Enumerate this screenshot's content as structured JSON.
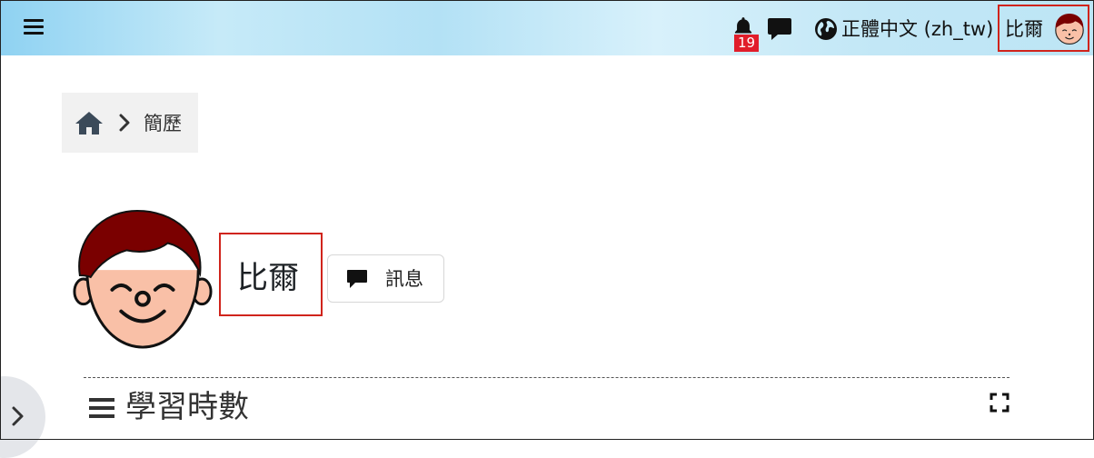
{
  "navbar": {
    "menu_icon": "hamburger-menu-icon",
    "notifications": {
      "icon": "bell-icon",
      "count": "19"
    },
    "messages_icon": "chat-bubble-icon",
    "language": {
      "icon": "globe-icon",
      "label": "正體中文 (zh_tw)"
    },
    "user": {
      "name": "比爾",
      "avatar": "avatar-icon"
    }
  },
  "breadcrumb": {
    "home_icon": "home-icon",
    "separator_icon": "chevron-right-icon",
    "current": "簡歷"
  },
  "profile": {
    "name": "比爾",
    "message_button": {
      "icon": "chat-bubble-icon",
      "label": "訊息"
    }
  },
  "section": {
    "icon": "menu-icon",
    "title": "學習時數",
    "fullscreen_icon": "fullscreen-icon"
  },
  "drawer": {
    "icon": "chevron-right-icon"
  },
  "colors": {
    "highlight_border": "#d0241c",
    "badge_bg": "#e11d2a",
    "navbar_gradient_start": "#8fd2f2",
    "hair": "#7a0000",
    "skin": "#f9c0a7"
  }
}
